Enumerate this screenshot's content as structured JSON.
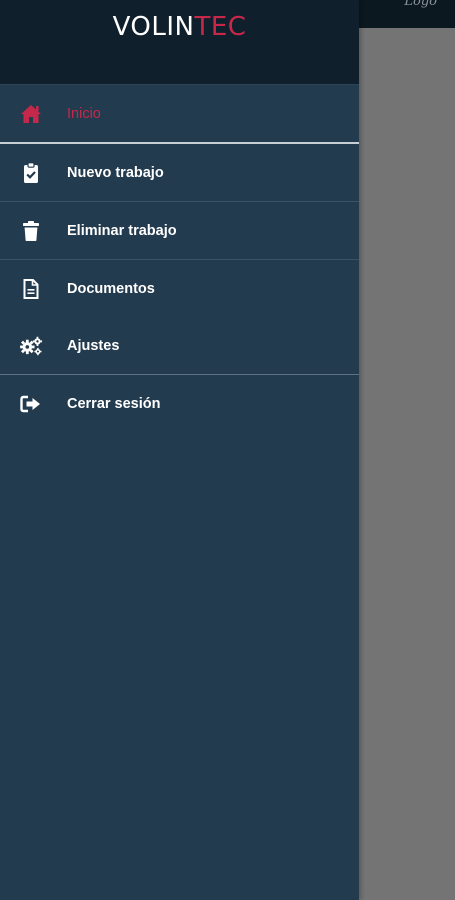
{
  "brand": {
    "part1": "VOLIN",
    "part2": "TEC"
  },
  "background": {
    "topbar_text": "Logo"
  },
  "menu": {
    "items": [
      {
        "label": "Inicio",
        "icon": "home-icon",
        "active": true
      },
      {
        "label": "Nuevo trabajo",
        "icon": "clipboard-check-icon"
      },
      {
        "label": "Eliminar trabajo",
        "icon": "trash-icon"
      },
      {
        "label": "Documentos",
        "icon": "document-icon"
      },
      {
        "label": "Ajustes",
        "icon": "cogs-icon"
      },
      {
        "label": "Cerrar sesión",
        "icon": "sign-out-icon"
      }
    ]
  },
  "colors": {
    "drawer_bg": "#233b4e",
    "header_bg": "#0f1f2b",
    "accent": "#c9274a",
    "overlay": "#747474"
  }
}
